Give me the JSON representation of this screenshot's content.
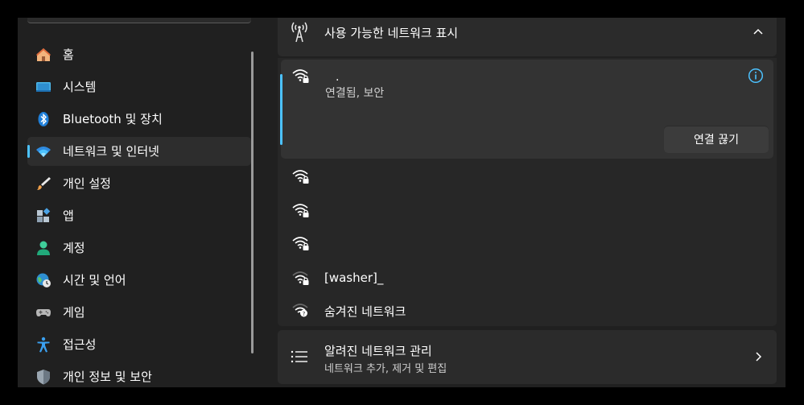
{
  "sidebar": {
    "items": [
      {
        "label": "홈",
        "icon": "home-icon"
      },
      {
        "label": "시스템",
        "icon": "system-icon"
      },
      {
        "label": "Bluetooth 및 장치",
        "icon": "bluetooth-icon"
      },
      {
        "label": "네트워크 및 인터넷",
        "icon": "wifi-icon",
        "selected": true
      },
      {
        "label": "개인 설정",
        "icon": "brush-icon"
      },
      {
        "label": "앱",
        "icon": "apps-icon"
      },
      {
        "label": "계정",
        "icon": "person-icon"
      },
      {
        "label": "시간 및 언어",
        "icon": "globe-clock-icon"
      },
      {
        "label": "게임",
        "icon": "gamepad-icon"
      },
      {
        "label": "접근성",
        "icon": "accessibility-icon"
      },
      {
        "label": "개인 정보 및 보안",
        "icon": "shield-icon"
      }
    ]
  },
  "available_networks": {
    "title": "사용 가능한 네트워크 표시",
    "connected": {
      "ssid": ".",
      "status": "연결됨, 보안",
      "disconnect_label": "연결 끊기"
    },
    "networks": [
      {
        "name": ""
      },
      {
        "name": ""
      },
      {
        "name": ""
      },
      {
        "name": "[washer]_"
      },
      {
        "name": "숨겨진 네트워크"
      }
    ]
  },
  "manage_known": {
    "title": "알려진 네트워크 관리",
    "subtitle": "네트워크 추가, 제거 및 편집"
  },
  "colors": {
    "accent": "#4cc2ff",
    "window_bg": "#202020",
    "card_bg": "#2b2b2b"
  }
}
